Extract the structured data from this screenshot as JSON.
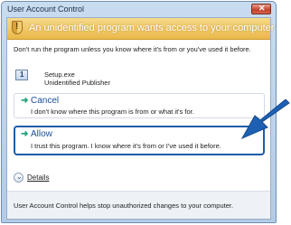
{
  "window": {
    "title": "User Account Control"
  },
  "banner": {
    "heading": "An unidentified program wants access to your computer"
  },
  "message": {
    "text": "Don't run the program unless you know where it's from or you've used it before."
  },
  "program": {
    "name": "Setup.exe",
    "publisher": "Unidentified Publisher"
  },
  "options": {
    "cancel": {
      "title": "Cancel",
      "description": "I don't know where this program is from or what it's for."
    },
    "allow": {
      "title": "Allow",
      "description": "I trust this program. I know where it's from or I've used it before."
    }
  },
  "details": {
    "label": "Details"
  },
  "footer": {
    "text": "User Account Control helps stop unauthorized changes to your computer."
  },
  "icons": {
    "shield": "shield-icon",
    "program": "program-icon",
    "close": "close-icon",
    "arrow": "arrow-right-icon",
    "details": "chevron-down-icon",
    "pointer": "pointer-arrow-icon"
  },
  "colors": {
    "banner": "#eab94a",
    "link": "#1c4f9c",
    "highlight": "#1f5ba8",
    "pointer": "#1d60b4"
  }
}
